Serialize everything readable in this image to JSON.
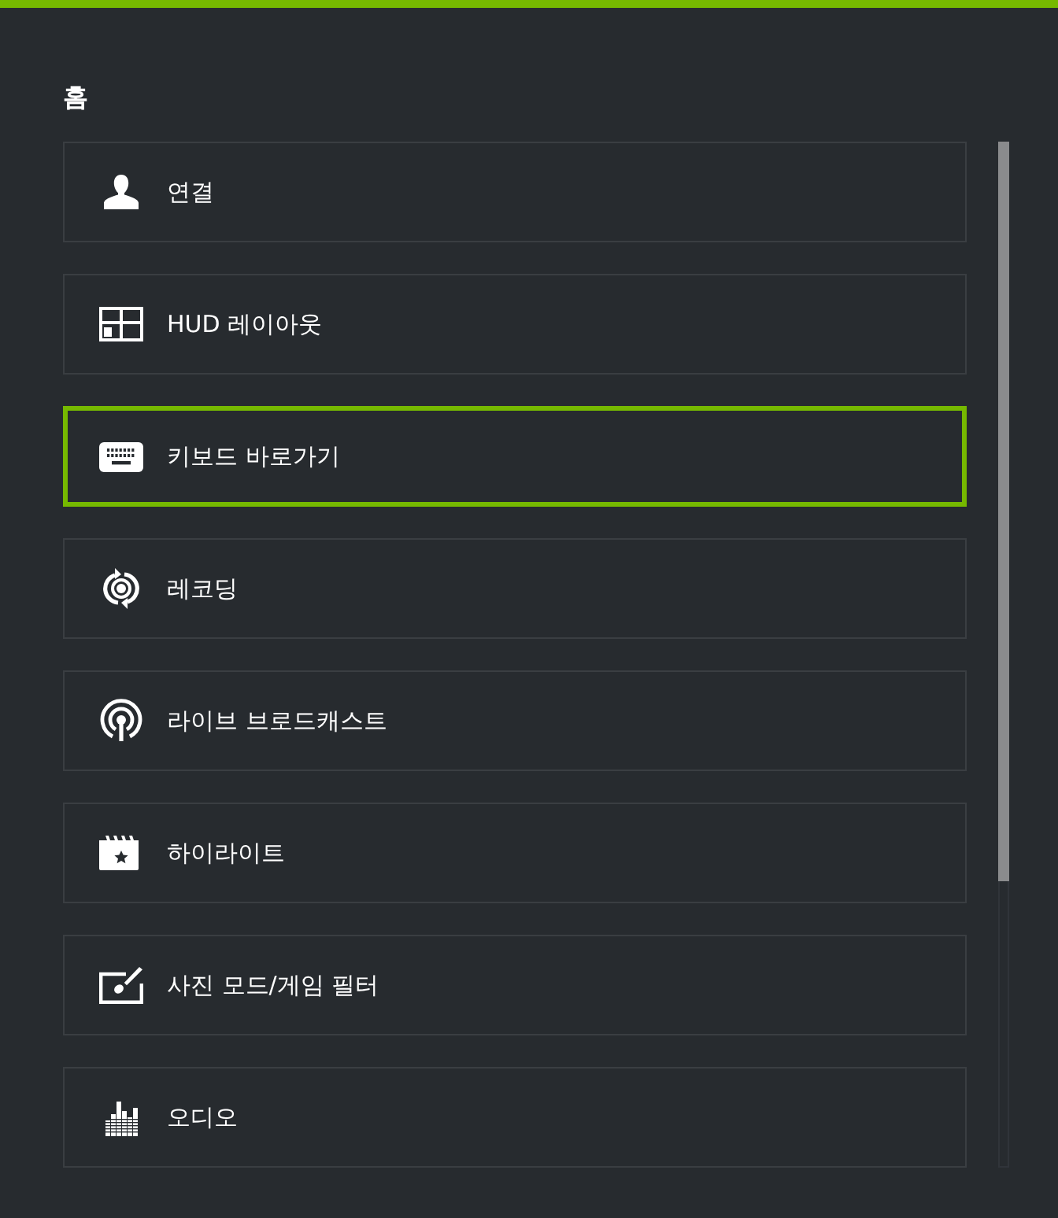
{
  "page": {
    "title": "홈"
  },
  "items": [
    {
      "label": "연결",
      "selected": false
    },
    {
      "label": "HUD 레이아웃",
      "selected": false
    },
    {
      "label": "키보드 바로가기",
      "selected": true
    },
    {
      "label": "레코딩",
      "selected": false
    },
    {
      "label": "라이브 브로드캐스트",
      "selected": false
    },
    {
      "label": "하이라이트",
      "selected": false
    },
    {
      "label": "사진 모드/게임 필터",
      "selected": false
    },
    {
      "label": "오디오",
      "selected": false
    }
  ]
}
